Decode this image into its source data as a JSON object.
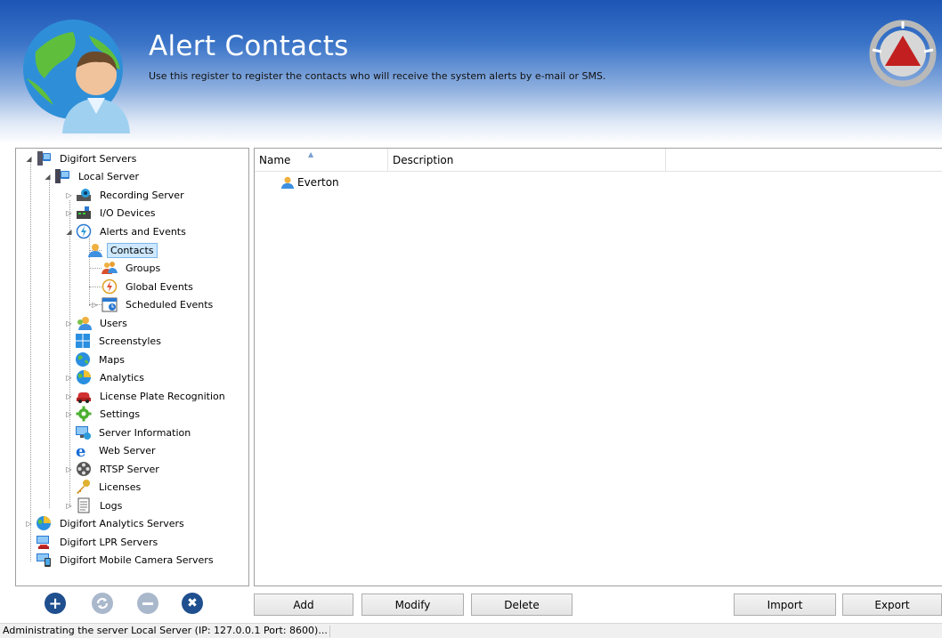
{
  "header": {
    "title": "Alert Contacts",
    "subtitle": "Use this register to register the contacts who will receive the system alerts by e-mail or SMS."
  },
  "tree": {
    "root": "Digifort Servers",
    "local_server": "Local Server",
    "recording_server": "Recording Server",
    "io_devices": "I/O Devices",
    "alerts_and_events": "Alerts and Events",
    "contacts": "Contacts",
    "groups": "Groups",
    "global_events": "Global Events",
    "scheduled_events": "Scheduled Events",
    "users": "Users",
    "screenstyles": "Screenstyles",
    "maps": "Maps",
    "analytics": "Analytics",
    "lpr": "License Plate Recognition",
    "settings": "Settings",
    "server_information": "Server Information",
    "web_server": "Web Server",
    "rtsp_server": "RTSP Server",
    "licenses": "Licenses",
    "logs": "Logs",
    "analytics_servers": "Digifort Analytics Servers",
    "lpr_servers": "Digifort LPR Servers",
    "mobile_camera_servers": "Digifort Mobile Camera Servers",
    "selected": "Contacts"
  },
  "list": {
    "columns": [
      "Name",
      "Description"
    ],
    "rows": [
      {
        "name": "Everton",
        "description": ""
      }
    ]
  },
  "buttons": {
    "add": "Add",
    "modify": "Modify",
    "delete": "Delete",
    "import": "Import",
    "export": "Export"
  },
  "tree_actions": [
    "add-icon",
    "refresh-icon",
    "remove-icon",
    "close-icon"
  ],
  "status": {
    "text": "Administrating the server Local Server (IP: 127.0.0.1 Port: 8600)..."
  },
  "colors": {
    "header_top": "#1d55b5",
    "selection": "#cde8ff",
    "action_button": "#1f4f8e",
    "action_button_disabled": "#aab8cc"
  }
}
